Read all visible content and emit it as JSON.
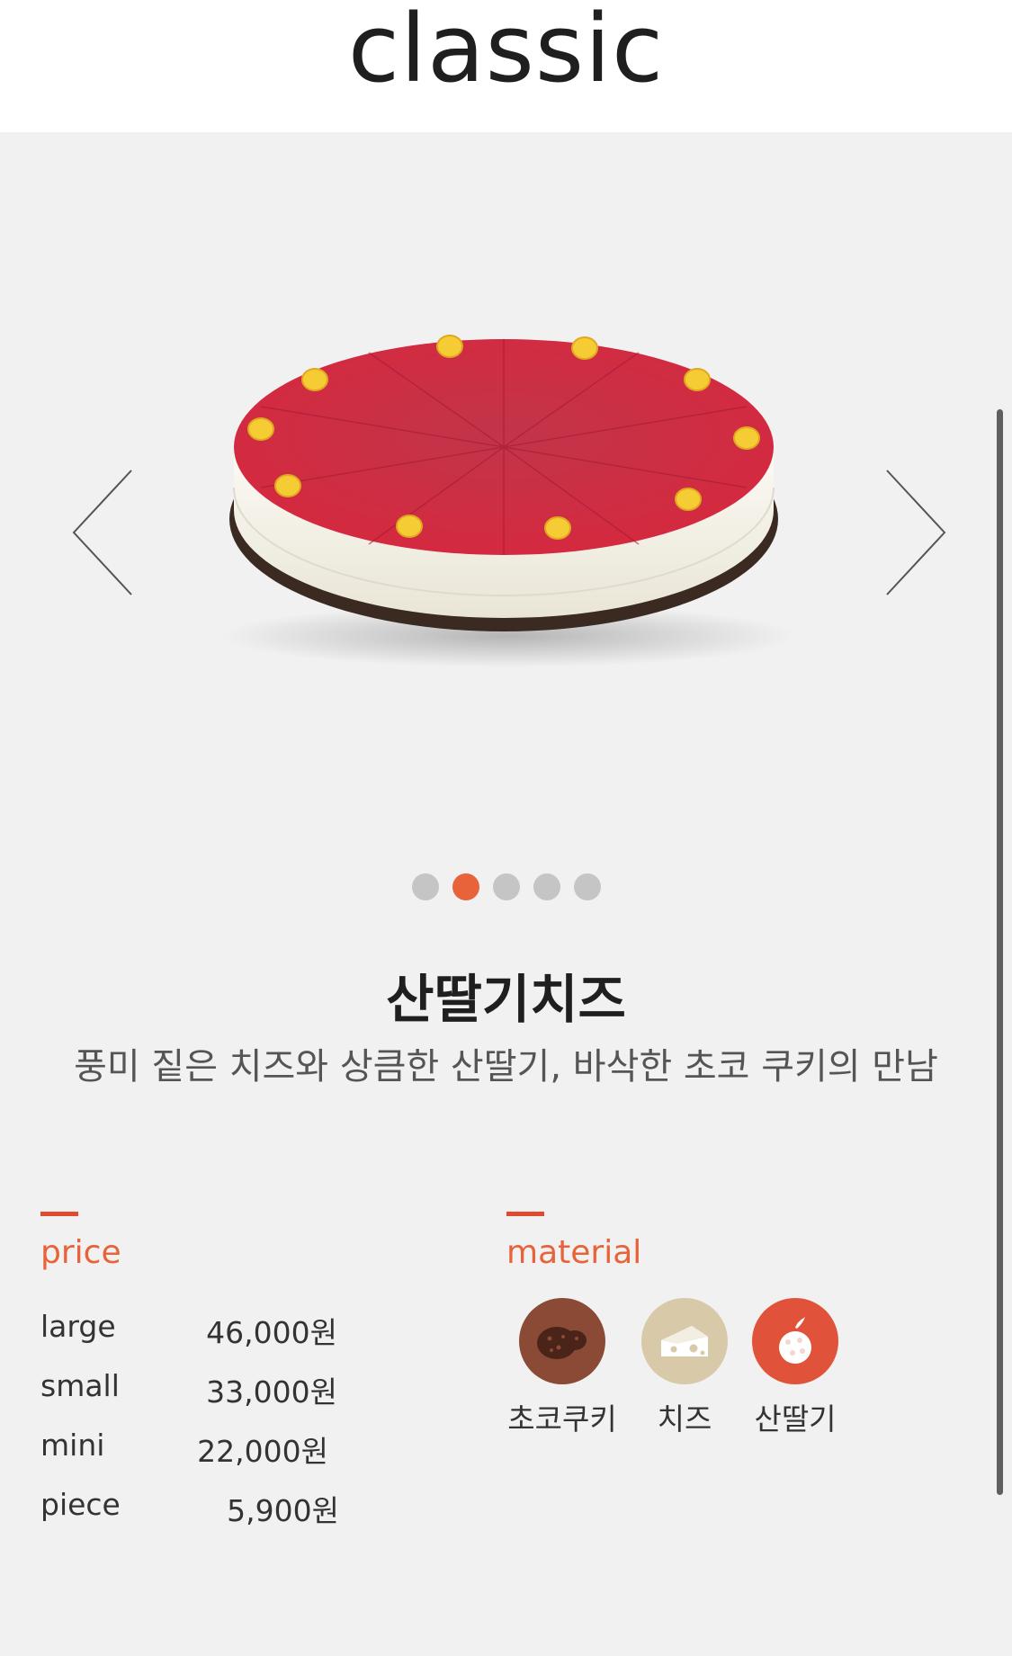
{
  "header": {
    "title": "classic"
  },
  "product": {
    "name": "산딸기치즈",
    "description": "풍미 짙은 치즈와 상큼한 산딸기, 바삭한 초코 쿠키의 만남"
  },
  "carousel": {
    "total_slides": 5,
    "active_slide": 2
  },
  "price": {
    "title": "price",
    "rows": [
      {
        "size": "large",
        "amount": "46,000원"
      },
      {
        "size": "small",
        "amount": "33,000원"
      },
      {
        "size": "mini",
        "amount": "22,000원"
      },
      {
        "size": "piece",
        "amount": "5,900원"
      }
    ]
  },
  "material": {
    "title": "material",
    "items": [
      {
        "label": "초코쿠키",
        "icon": "cookie-icon",
        "color": "#8a4a36"
      },
      {
        "label": "치즈",
        "icon": "cheese-icon",
        "color": "#d8c9a9"
      },
      {
        "label": "산딸기",
        "icon": "raspberry-icon",
        "color": "#e0533a"
      }
    ]
  },
  "colors": {
    "accent": "#e8623a",
    "accent_bar": "#e34a2d",
    "dot_inactive": "#c5c5c5"
  }
}
